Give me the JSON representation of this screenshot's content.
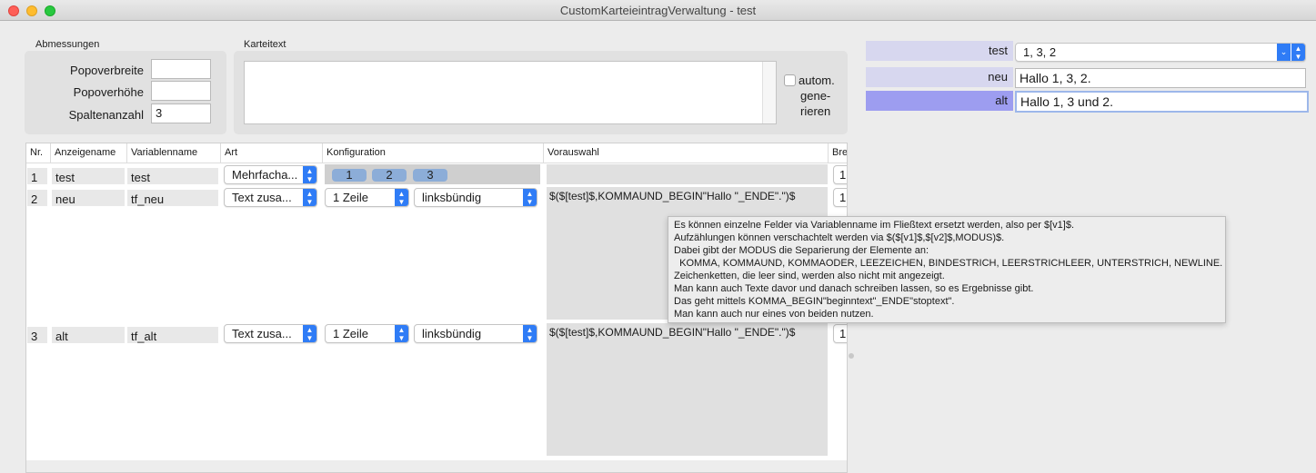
{
  "window": {
    "title": "CustomKarteieintragVerwaltung - test"
  },
  "abmessungen": {
    "label": "Abmessungen",
    "fields": [
      {
        "label": "Popoverbreite",
        "value": ""
      },
      {
        "label": "Popoverhöhe",
        "value": ""
      },
      {
        "label": "Spaltenanzahl",
        "value": "3"
      }
    ]
  },
  "karteitext": {
    "label": "Karteitext",
    "value": "",
    "auto_label_1": "autom.",
    "auto_label_2": "gene-",
    "auto_label_3": "rieren"
  },
  "table": {
    "headers": [
      "Nr.",
      "Anzeigename",
      "Variablenname",
      "Art",
      "Konfiguration",
      "Vorauswahl",
      "Bre"
    ],
    "rows": [
      {
        "nr": "1",
        "anzeige": "test",
        "variable": "test",
        "art": "Mehrfacha...",
        "chips": [
          "1",
          "2",
          "3"
        ],
        "vorauswahl": "",
        "breite": "1"
      },
      {
        "nr": "2",
        "anzeige": "neu",
        "variable": "tf_neu",
        "art": "Text zusa...",
        "zeilen": "1 Zeile",
        "ausrichtung": "linksbündig",
        "vorauswahl": "$($[test]$,KOMMAUND_BEGIN\"Hallo \"_ENDE\".\")$",
        "breite": "1"
      },
      {
        "nr": "3",
        "anzeige": "alt",
        "variable": "tf_alt",
        "art": "Text zusa...",
        "zeilen": "1 Zeile",
        "ausrichtung": "linksbündig",
        "vorauswahl": "$($[test]$,KOMMAUND_BEGIN\"Hallo \"_ENDE\".\")$",
        "breite": "1"
      }
    ]
  },
  "tooltip": {
    "lines": [
      "Es können einzelne Felder via Variablenname im Fließtext ersetzt werden, also per $[v1]$.",
      "Aufzählungen können verschachtelt werden via $($[v1]$,$[v2]$,MODUS)$.",
      "Dabei gibt der MODUS die Separierung der Elemente an:",
      "  KOMMA, KOMMAUND, KOMMAODER, LEEZEICHEN, BINDESTRICH, LEERSTRICHLEER, UNTERSTRICH, NEWLINE.",
      "Zeichenketten, die leer sind, werden also nicht mit angezeigt.",
      "Man kann auch Texte davor und danach schreiben lassen, so es Ergebnisse gibt.",
      "Das geht mittels KOMMA_BEGIN\"beginntext\"_ENDE\"stoptext\".",
      "Man kann auch nur eines von beiden nutzen."
    ]
  },
  "preview": [
    {
      "label": "test",
      "value": "1, 3, 2"
    },
    {
      "label": "neu",
      "value": "Hallo 1, 3, 2."
    },
    {
      "label": "alt",
      "value": "Hallo 1,  3 und  2."
    }
  ],
  "colors": {
    "accent": "#2f7cf6",
    "chip": "#8cadd8",
    "preview_label": "#d7d7ef",
    "preview_label_active": "#9d9df0"
  }
}
